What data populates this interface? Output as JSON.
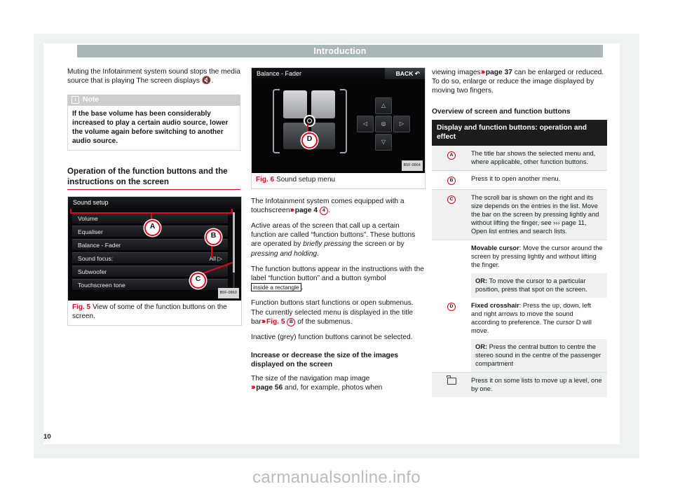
{
  "header": {
    "chapter": "Introduction"
  },
  "footer": {
    "page_number": "10",
    "watermark": "carmanualsonline.info"
  },
  "left_column": {
    "intro_p1_a": "Muting the Infotainment system sound stops the media source that is playing The screen displays",
    "mute_icon": "mute-speaker-icon",
    "intro_p1_b": ".",
    "note": {
      "icon": "info-icon",
      "title": "Note",
      "body": "If the base volume has been considerably increased to play a certain audio source, lower the volume again before switching to another audio source."
    },
    "section_heading": "Operation of the function buttons and the instructions on the screen",
    "fig5": {
      "label": "Fig. 5",
      "caption": "View of some of the function buttons on the screen.",
      "code": "B5F-0863",
      "screen_title": "Sound setup",
      "rows": [
        {
          "label": "Volume",
          "value": ""
        },
        {
          "label": "Equaliser",
          "value": ""
        },
        {
          "label": "Balance - Fader",
          "value": ""
        },
        {
          "label": "Sound focus:",
          "value": "All ▷"
        },
        {
          "label": "Subwoofer",
          "value": ""
        },
        {
          "label": "Touchscreen tone",
          "value": ""
        }
      ],
      "callouts": [
        "A",
        "B",
        "C"
      ]
    }
  },
  "middle_column": {
    "fig6": {
      "label": "Fig. 6",
      "caption": "Sound setup menu",
      "code": "B5F-0864",
      "screen_title": "Balance - Fader",
      "back_label": "BACK",
      "back_icon": "back-arrow-icon",
      "callout": "D",
      "dpad": {
        "up": "△",
        "down": "▽",
        "left": "◁",
        "right": "▷",
        "center": "◎"
      }
    },
    "p1_a": "The Infotainment system comes equipped with a touchscreen",
    "p1_ref": "page 4",
    "p1_circle": "4",
    "p1_b": ".",
    "p2": "Active areas of the screen that call up a certain function are called “function buttons”. These buttons are operated by",
    "p2_i1": "briefly pressing",
    "p2_mid": "the screen or by",
    "p2_i2": "pressing and holding",
    "p2_end": ".",
    "p3_a": "The function buttons appear in the instructions with the label “function button” and a button symbol",
    "p3_rect": "inside a rectangle",
    "p3_b": ".",
    "p4_a": "Function buttons start functions or open submenus. The currently selected menu is displayed in the title bar",
    "p4_ref": "Fig. 5",
    "p4_circle": "B",
    "p4_b": "of the submenus.",
    "p5": "Inactive (grey) function buttons cannot be selected.",
    "sub_heading": "Increase or decrease the size of the images displayed on the screen",
    "p6_a": "The size of the navigation map image",
    "p6_ref": "page 56",
    "p6_b": "and, for example, photos when"
  },
  "right_column": {
    "p1_a": "viewing images",
    "p1_ref": "page 37",
    "p1_b": "can be enlarged or reduced. To do so, enlarge or reduce the image displayed by moving two fingers.",
    "sub_heading": "Overview of screen and function buttons",
    "table": {
      "header": "Display and function buttons: operation and effect",
      "rows": [
        {
          "key": "A",
          "key_type": "circle",
          "cells": [
            {
              "text": "The title bar shows the selected menu and, where applicable, other function buttons.",
              "shade": true
            }
          ]
        },
        {
          "key": "B",
          "key_type": "circle",
          "cells": [
            {
              "text": "Press it to open another menu.",
              "shade": false
            }
          ]
        },
        {
          "key": "C",
          "key_type": "circle",
          "cells": [
            {
              "text": "The scroll bar is shown on the right and its size depends on the entries in the list. Move the bar on the screen by pressing lightly and without lifting the finger, see ››› page 11, Open list entries and search lists.",
              "shade": true
            }
          ]
        },
        {
          "key": "D",
          "key_type": "circle",
          "cells": [
            {
              "bold": "Movable cursor",
              "text": ": Move the cursor around the screen by pressing lightly and without lifting the finger.",
              "shade": false
            },
            {
              "bold": "OR:",
              "text": " To move the cursor to a particular position, press that spot on the screen.",
              "shade": true
            },
            {
              "bold": "Fixed crosshair",
              "text": ": Press the up, down, left and right arrows to move the sound according to preference. The cursor D will move.",
              "shade": false
            },
            {
              "bold": "OR:",
              "text": " Press the central button to centre the stereo sound in the centre of the passenger compartment",
              "shade": true
            }
          ]
        },
        {
          "key": "folder-icon",
          "key_type": "icon",
          "cells": [
            {
              "text": "Press it on some lists to move up a level, one by one.",
              "shade": true
            }
          ]
        }
      ]
    }
  }
}
